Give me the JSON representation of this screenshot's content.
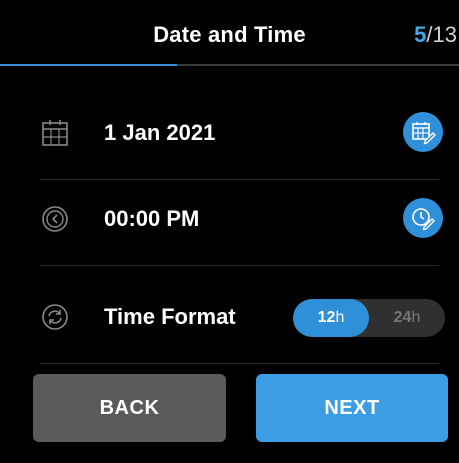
{
  "header": {
    "title": "Date and Time",
    "step_current": "5",
    "step_separator": "/",
    "step_total": "13",
    "progress_fraction": 0.385
  },
  "rows": {
    "date": {
      "value": "1 Jan 2021",
      "icon": "calendar-icon",
      "action_icon": "edit-calendar-icon"
    },
    "time": {
      "value": "00:00 PM",
      "icon": "clock-icon",
      "action_icon": "edit-clock-icon"
    },
    "format": {
      "label": "Time Format",
      "icon": "sync-icon",
      "options": [
        {
          "value": "12",
          "suffix": "h",
          "selected": true
        },
        {
          "value": "24",
          "suffix": "h",
          "selected": false
        }
      ]
    }
  },
  "buttons": {
    "back": "BACK",
    "next": "NEXT"
  },
  "colors": {
    "accent": "#2f8fd8",
    "progress": "#3b8fd6",
    "back": "#5a5a5a",
    "next": "#3c9de3"
  }
}
